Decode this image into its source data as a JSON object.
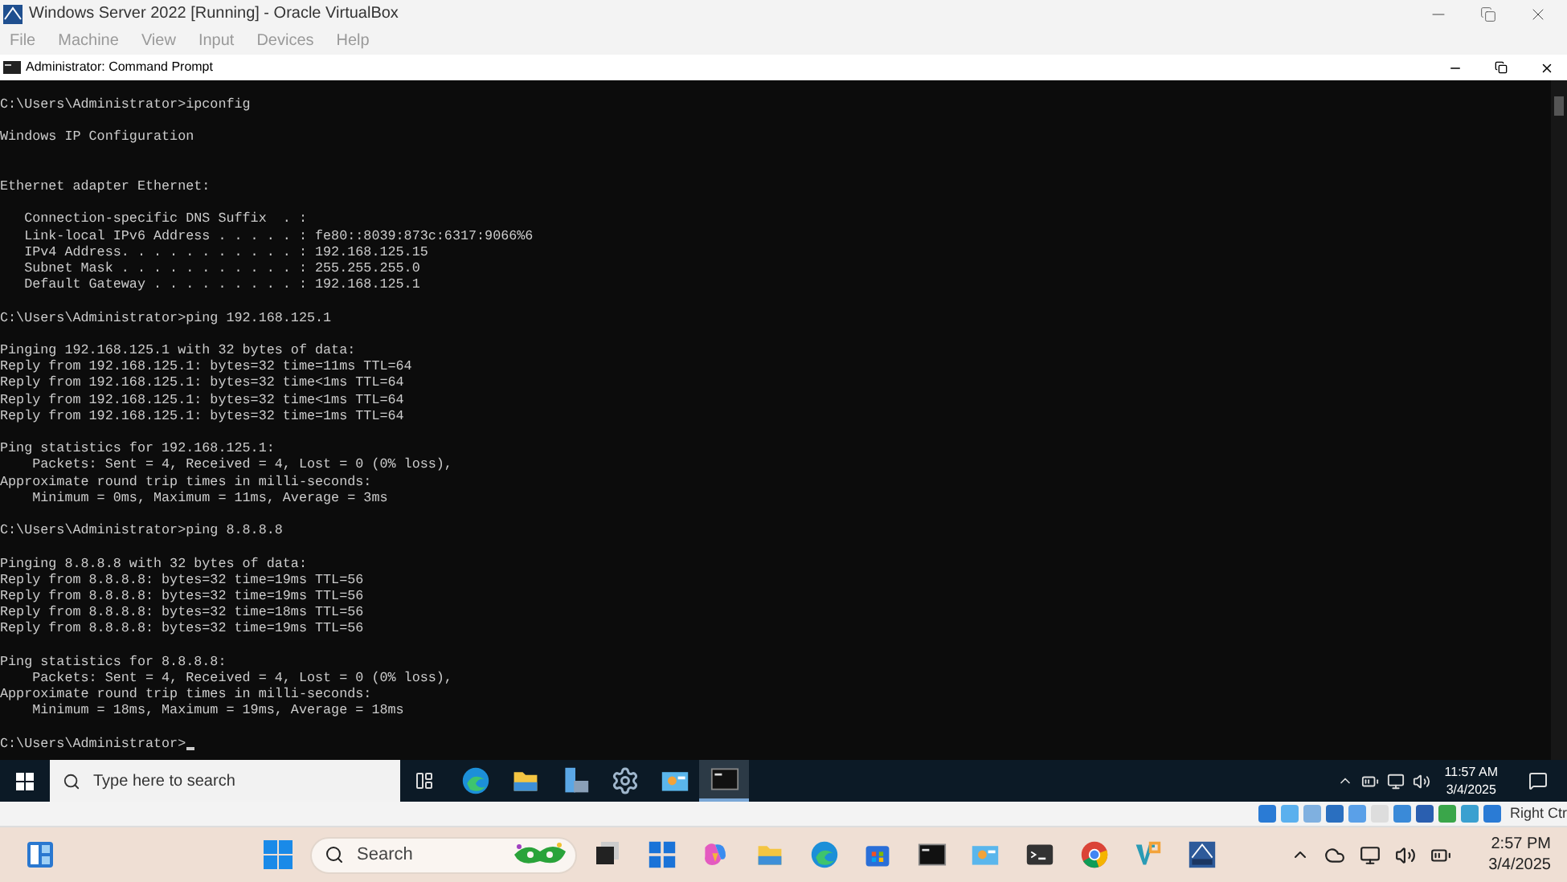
{
  "window": {
    "title": "Windows Server 2022 [Running] - Oracle VirtualBox"
  },
  "menu": [
    "File",
    "Machine",
    "View",
    "Input",
    "Devices",
    "Help"
  ],
  "console_window": {
    "title": "Administrator: Command Prompt",
    "lines": [
      {
        "kind": "text",
        "text": "C:\\Users\\Administrator>ipconfig"
      },
      {
        "kind": "blank"
      },
      {
        "kind": "text",
        "text": "Windows IP Configuration"
      },
      {
        "kind": "blank"
      },
      {
        "kind": "blank"
      },
      {
        "kind": "text",
        "text": "Ethernet adapter Ethernet:"
      },
      {
        "kind": "blank"
      },
      {
        "kind": "text",
        "text": "   Connection-specific DNS Suffix  . :"
      },
      {
        "kind": "text",
        "text": "   Link-local IPv6 Address . . . . . : fe80::8039:873c:6317:9066%6"
      },
      {
        "kind": "text",
        "text": "   IPv4 Address. . . . . . . . . . . : 192.168.125.15"
      },
      {
        "kind": "text",
        "text": "   Subnet Mask . . . . . . . . . . . : 255.255.255.0"
      },
      {
        "kind": "text",
        "text": "   Default Gateway . . . . . . . . . : 192.168.125.1"
      },
      {
        "kind": "blank"
      },
      {
        "kind": "text",
        "text": "C:\\Users\\Administrator>ping 192.168.125.1"
      },
      {
        "kind": "blank"
      },
      {
        "kind": "text",
        "text": "Pinging 192.168.125.1 with 32 bytes of data:"
      },
      {
        "kind": "text",
        "text": "Reply from 192.168.125.1: bytes=32 time=11ms TTL=64"
      },
      {
        "kind": "text",
        "text": "Reply from 192.168.125.1: bytes=32 time<1ms TTL=64"
      },
      {
        "kind": "text",
        "text": "Reply from 192.168.125.1: bytes=32 time<1ms TTL=64"
      },
      {
        "kind": "text",
        "text": "Reply from 192.168.125.1: bytes=32 time=1ms TTL=64"
      },
      {
        "kind": "blank"
      },
      {
        "kind": "text",
        "text": "Ping statistics for 192.168.125.1:"
      },
      {
        "kind": "text",
        "text": "    Packets: Sent = 4, Received = 4, Lost = 0 (0% loss),"
      },
      {
        "kind": "text",
        "text": "Approximate round trip times in milli-seconds:"
      },
      {
        "kind": "text",
        "text": "    Minimum = 0ms, Maximum = 11ms, Average = 3ms"
      },
      {
        "kind": "blank"
      },
      {
        "kind": "text",
        "text": "C:\\Users\\Administrator>ping 8.8.8.8"
      },
      {
        "kind": "blank"
      },
      {
        "kind": "text",
        "text": "Pinging 8.8.8.8 with 32 bytes of data:"
      },
      {
        "kind": "text",
        "text": "Reply from 8.8.8.8: bytes=32 time=19ms TTL=56"
      },
      {
        "kind": "text",
        "text": "Reply from 8.8.8.8: bytes=32 time=19ms TTL=56"
      },
      {
        "kind": "text",
        "text": "Reply from 8.8.8.8: bytes=32 time=18ms TTL=56"
      },
      {
        "kind": "text",
        "text": "Reply from 8.8.8.8: bytes=32 time=19ms TTL=56"
      },
      {
        "kind": "blank"
      },
      {
        "kind": "text",
        "text": "Ping statistics for 8.8.8.8:"
      },
      {
        "kind": "text",
        "text": "    Packets: Sent = 4, Received = 4, Lost = 0 (0% loss),"
      },
      {
        "kind": "text",
        "text": "Approximate round trip times in milli-seconds:"
      },
      {
        "kind": "text",
        "text": "    Minimum = 18ms, Maximum = 19ms, Average = 18ms"
      },
      {
        "kind": "blank"
      },
      {
        "kind": "prompt",
        "text": "C:\\Users\\Administrator>"
      }
    ]
  },
  "guest_taskbar": {
    "search": {
      "placeholder": "Type here to search"
    },
    "apps": [
      {
        "kind": "edge",
        "selected": false
      },
      {
        "kind": "folder",
        "selected": false
      },
      {
        "kind": "server",
        "selected": false
      },
      {
        "kind": "gear",
        "selected": false
      },
      {
        "kind": "panel",
        "selected": false
      },
      {
        "kind": "terminal",
        "selected": true
      }
    ],
    "time": "11:57 AM",
    "date": "3/4/2025"
  },
  "status_bar": {
    "host_key": "Right Ctr"
  },
  "host_taskbar": {
    "search": {
      "placeholder": "Search"
    },
    "apps": [
      {
        "kind": "windows"
      },
      {
        "kind": "copilot"
      },
      {
        "kind": "folder"
      },
      {
        "kind": "edge"
      },
      {
        "kind": "store"
      },
      {
        "kind": "terminal"
      },
      {
        "kind": "panel"
      },
      {
        "kind": "shell"
      },
      {
        "kind": "chrome"
      },
      {
        "kind": "code"
      },
      {
        "kind": "vbox"
      }
    ],
    "time": "2:57 PM",
    "date": "3/4/2025"
  }
}
